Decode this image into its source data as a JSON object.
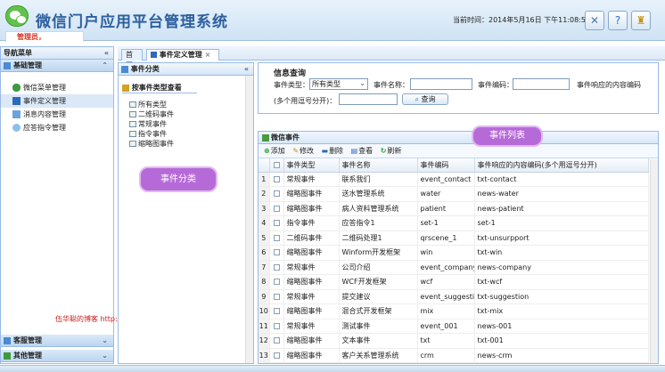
{
  "header": {
    "app_title": "微信门户应用平台管理系统",
    "admin_role": "管理员，",
    "admin_greeting": "您好！",
    "clock": "当前时间：2014年5月16日 下午11:08:57"
  },
  "nav": {
    "title": "导航菜单",
    "group_basic": "基础管理",
    "items": [
      {
        "label": "微信菜单管理",
        "icon": "users-icon"
      },
      {
        "label": "事件定义管理",
        "icon": "table-icon"
      },
      {
        "label": "消息内容管理",
        "icon": "message-icon"
      },
      {
        "label": "应答指令管理",
        "icon": "chat-icon"
      }
    ],
    "group_customer": "客服管理",
    "group_other": "其他管理"
  },
  "watermark": "伍华聪的博客 http://wuhuacong.cnblogs.com",
  "tabs": [
    {
      "label": "首页"
    },
    {
      "label": "事件定义管理"
    }
  ],
  "category_panel": {
    "title": "事件分类",
    "tree_header": "按事件类型查看",
    "nodes": [
      "所有类型",
      "二维码事件",
      "常规事件",
      "指令事件",
      "缩略图事件"
    ]
  },
  "query": {
    "title": "信息查询",
    "type_label": "事件类型：",
    "type_value": "所有类型",
    "name_label": "事件名称：",
    "name_value": "",
    "code_label": "事件编码：",
    "code_value": "",
    "content_label": "事件响应的内容编码",
    "content_hint": "(多个用逗号分开)：",
    "content_value": "",
    "search_button": "查询"
  },
  "grid": {
    "title": "微信事件",
    "toolbar": {
      "add": "添加",
      "edit": "修改",
      "delete": "删除",
      "view": "查看",
      "refresh": "刷新"
    },
    "columns": [
      "事件类型",
      "事件名称",
      "事件编码",
      "事件响应的内容编码(多个用逗号分开)"
    ],
    "rows": [
      {
        "n": "1",
        "type": "常规事件",
        "name": "联系我们",
        "code": "event_contact",
        "content": "txt-contact"
      },
      {
        "n": "2",
        "type": "缩略图事件",
        "name": "送水管理系统",
        "code": "water",
        "content": "news-water"
      },
      {
        "n": "3",
        "type": "缩略图事件",
        "name": "病人资料管理系统",
        "code": "patient",
        "content": "news-patient"
      },
      {
        "n": "4",
        "type": "指令事件",
        "name": "应答指令1",
        "code": "set-1",
        "content": "set-1"
      },
      {
        "n": "5",
        "type": "二维码事件",
        "name": "二维码处理1",
        "code": "qrscene_1",
        "content": "txt-unsurpport"
      },
      {
        "n": "6",
        "type": "缩略图事件",
        "name": "Winform开发框架",
        "code": "win",
        "content": "txt-win"
      },
      {
        "n": "7",
        "type": "常规事件",
        "name": "公司介绍",
        "code": "event_company",
        "content": "news-company"
      },
      {
        "n": "8",
        "type": "缩略图事件",
        "name": "WCF开发框架",
        "code": "wcf",
        "content": "txt-wcf"
      },
      {
        "n": "9",
        "type": "常规事件",
        "name": "提交建议",
        "code": "event_suggestion",
        "content": "txt-suggestion"
      },
      {
        "n": "10",
        "type": "缩略图事件",
        "name": "混合式开发框架",
        "code": "mix",
        "content": "txt-mix"
      },
      {
        "n": "11",
        "type": "常规事件",
        "name": "测试事件",
        "code": "event_001",
        "content": "news-001"
      },
      {
        "n": "12",
        "type": "缩略图事件",
        "name": "文本事件",
        "code": "txt",
        "content": "txt-001"
      },
      {
        "n": "13",
        "type": "缩略图事件",
        "name": "客户关系管理系统",
        "code": "crm",
        "content": "news-crm"
      }
    ]
  },
  "callouts": {
    "event_list": "事件列表",
    "event_category": "事件分类"
  }
}
